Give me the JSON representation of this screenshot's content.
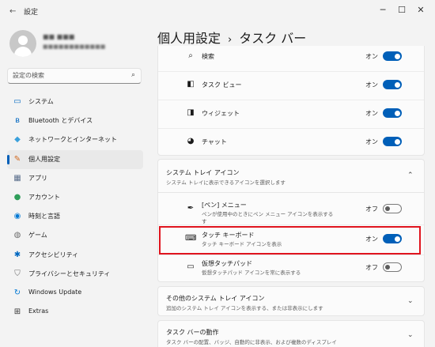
{
  "window": {
    "app_title": "設定",
    "minimize_glyph": "─",
    "maximize_glyph": "☐",
    "close_glyph": "✕",
    "back_glyph": "←"
  },
  "user": {
    "name": "■■ ■■■",
    "email": "■■■■■■■■■■■■"
  },
  "search": {
    "placeholder": "設定の検索",
    "icon_glyph": "⌕"
  },
  "sidebar": {
    "items": [
      {
        "label": "システム",
        "icon": "system-icon",
        "glyph": "▭",
        "color": "#0067c0"
      },
      {
        "label": "Bluetooth とデバイス",
        "icon": "bluetooth-icon",
        "glyph": "ʙ",
        "color": "#0067c0"
      },
      {
        "label": "ネットワークとインターネット",
        "icon": "wifi-icon",
        "glyph": "◆",
        "color": "#3aa0dc"
      },
      {
        "label": "個人用設定",
        "icon": "brush-icon",
        "glyph": "✎",
        "color": "#d2691e"
      },
      {
        "label": "アプリ",
        "icon": "apps-icon",
        "glyph": "▦",
        "color": "#5b6f8c"
      },
      {
        "label": "アカウント",
        "icon": "account-icon",
        "glyph": "●",
        "color": "#2f9e5a"
      },
      {
        "label": "時刻と言語",
        "icon": "globe-clock-icon",
        "glyph": "◉",
        "color": "#0078d4"
      },
      {
        "label": "ゲーム",
        "icon": "gamepad-icon",
        "glyph": "◍",
        "color": "#6d6d6d"
      },
      {
        "label": "アクセシビリティ",
        "icon": "accessibility-icon",
        "glyph": "✱",
        "color": "#0067c0"
      },
      {
        "label": "プライバシーとセキュリティ",
        "icon": "shield-icon",
        "glyph": "⛉",
        "color": "#6d6d6d"
      },
      {
        "label": "Windows Update",
        "icon": "windows-update-icon",
        "glyph": "↻",
        "color": "#0078d4"
      },
      {
        "label": "Extras",
        "icon": "extras-icon",
        "glyph": "⊞",
        "color": "#333333"
      }
    ]
  },
  "breadcrumb": {
    "parent": "個人用設定",
    "separator": "›",
    "current": "タスク バー"
  },
  "taskbar_items": [
    {
      "label": "検索",
      "icon": "search-icon",
      "glyph": "⌕",
      "state": "オン"
    },
    {
      "label": "タスク ビュー",
      "icon": "task-view-icon",
      "glyph": "◧",
      "state": "オン"
    },
    {
      "label": "ウィジェット",
      "icon": "widgets-icon",
      "glyph": "◨",
      "state": "オン"
    },
    {
      "label": "チャット",
      "icon": "chat-icon",
      "glyph": "◕",
      "state": "オン"
    }
  ],
  "tray_section": {
    "title": "システム トレイ アイコン",
    "subtitle": "システム トレイに表示できるアイコンを選択します",
    "chevron": "⌃",
    "items": [
      {
        "label": "[ペン] メニュー",
        "sub": "ペンが使用中のときにペン メニュー アイコンを表示する",
        "sub2": "す",
        "icon": "pen-icon",
        "glyph": "✒",
        "state": "オフ"
      },
      {
        "label": "タッチ キーボード",
        "sub": "タッチ キーボード アイコンを表示",
        "sub2": "",
        "icon": "keyboard-icon",
        "glyph": "⌨",
        "state": "オン"
      },
      {
        "label": "仮想タッチパッド",
        "sub": "仮想タッチパッド アイコンを常に表示する",
        "sub2": "",
        "icon": "touchpad-icon",
        "glyph": "▭",
        "state": "オフ"
      }
    ]
  },
  "other_tray": {
    "title": "その他のシステム トレイ アイコン",
    "subtitle": "追加のシステム トレイ アイコンを表示する、または非表示にします",
    "chevron": "⌄"
  },
  "behavior": {
    "title": "タスク バーの動作",
    "subtitle": "タスク バーの配置、バッジ、自動的に非表示、および複数のディスプレイ",
    "chevron": "⌄"
  },
  "colors": {
    "accent": "#005fb8",
    "highlight_box": "#e0141e"
  }
}
